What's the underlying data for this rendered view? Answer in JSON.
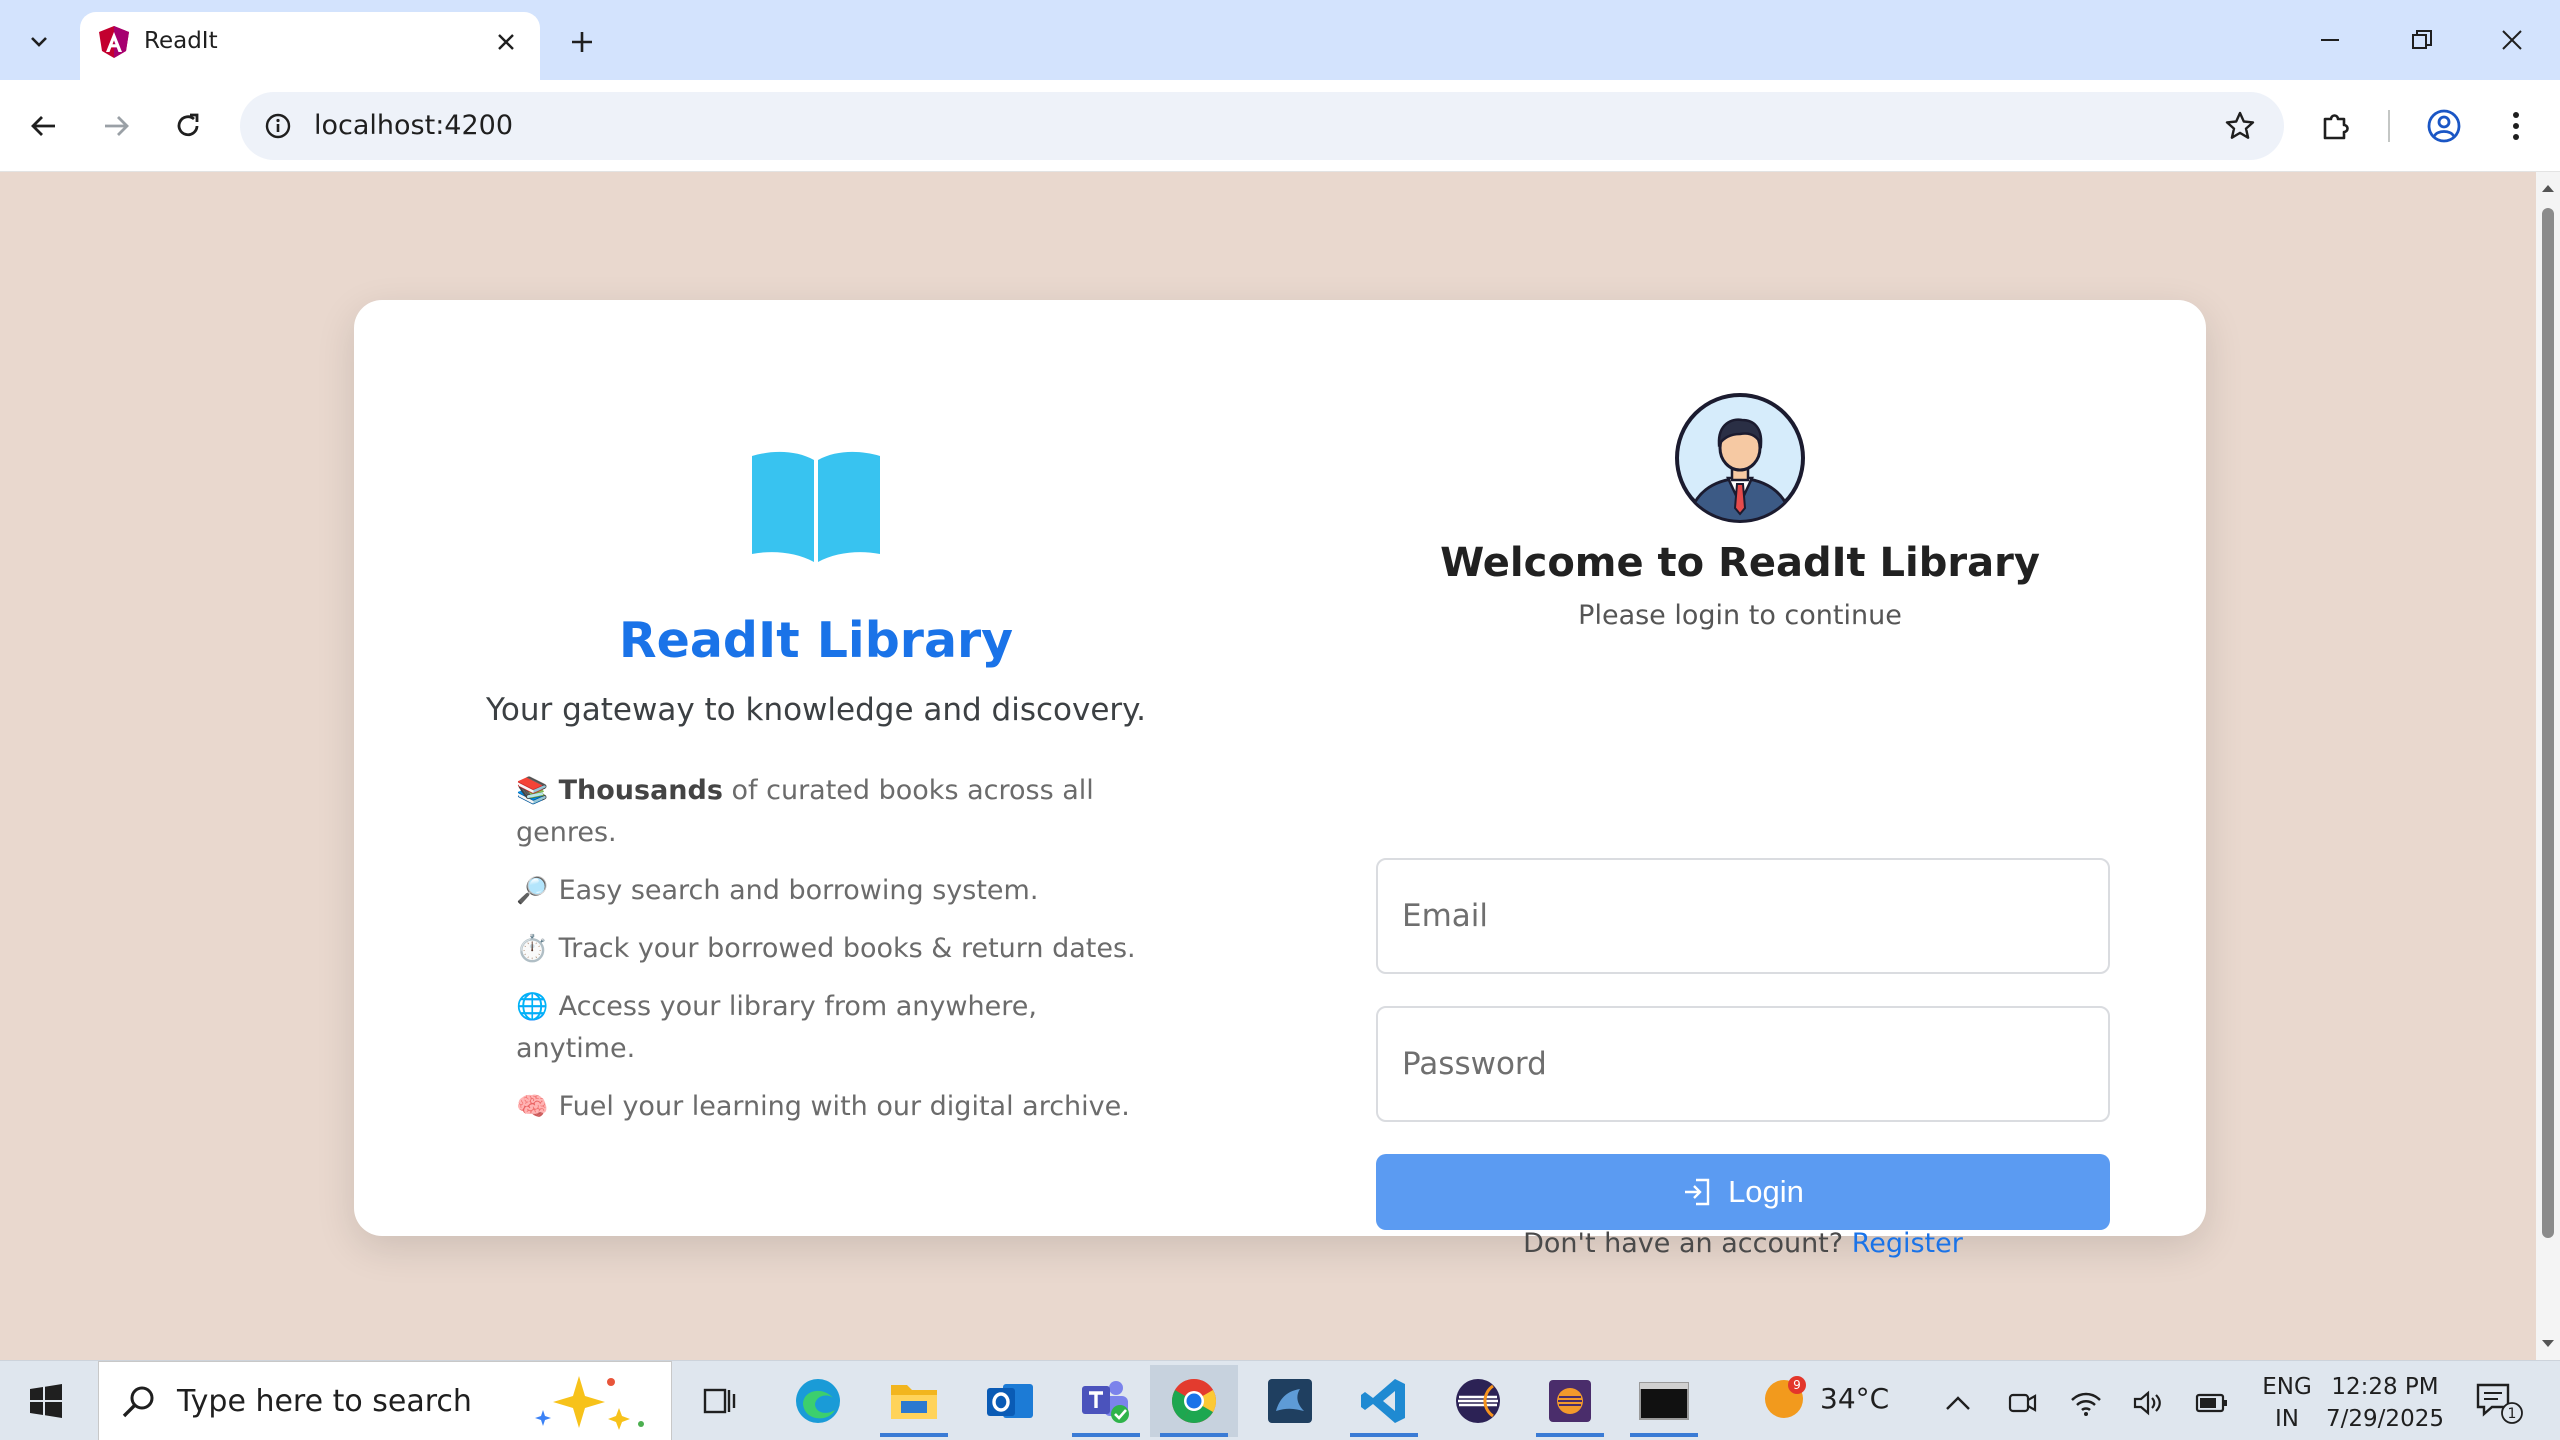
{
  "browser": {
    "tab_title": "ReadIt",
    "url": "localhost:4200"
  },
  "page": {
    "brand_title": "ReadIt Library",
    "tagline": "Your gateway to knowledge and discovery.",
    "features": [
      {
        "emoji": "📚",
        "bold": "Thousands",
        "text": " of curated books across all genres."
      },
      {
        "emoji": "🔎",
        "bold": "",
        "text": "Easy search and borrowing system."
      },
      {
        "emoji": "⏱️",
        "bold": "",
        "text": "Track your borrowed books & return dates."
      },
      {
        "emoji": "🌐",
        "bold": "",
        "text": "Access your library from anywhere, anytime."
      },
      {
        "emoji": "🧠",
        "bold": "",
        "text": "Fuel your learning with our digital archive."
      }
    ],
    "welcome": "Welcome to ReadIt Library",
    "subtitle": "Please login to continue",
    "email_placeholder": "Email",
    "password_placeholder": "Password",
    "login_label": "Login",
    "register_prompt": "Don't have an account? ",
    "register_link": "Register"
  },
  "taskbar": {
    "search_placeholder": "Type here to search",
    "weather_temp": "34°C",
    "weather_badge": "9",
    "lang_line1": "ENG",
    "lang_line2": "IN",
    "time": "12:28 PM",
    "date": "7/29/2025",
    "notif_count": "1"
  },
  "colors": {
    "page_bg": "#e9d8ce",
    "brand": "#1a73e8",
    "login_button": "#5b9bf2",
    "book_icon": "#38c3f0"
  }
}
